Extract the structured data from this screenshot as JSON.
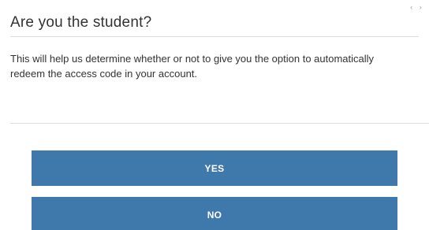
{
  "dialog": {
    "title": "Are you the student?",
    "close_icon": "close-icon",
    "message": "This will help us determine whether or not to give you the option to automatically redeem the access code in your account.",
    "buttons": {
      "yes_label": "YES",
      "no_label": "NO"
    }
  },
  "colors": {
    "button_background": "#3f78ab",
    "button_text": "#ffffff",
    "divider": "#dcdcdc",
    "text": "#333333"
  }
}
